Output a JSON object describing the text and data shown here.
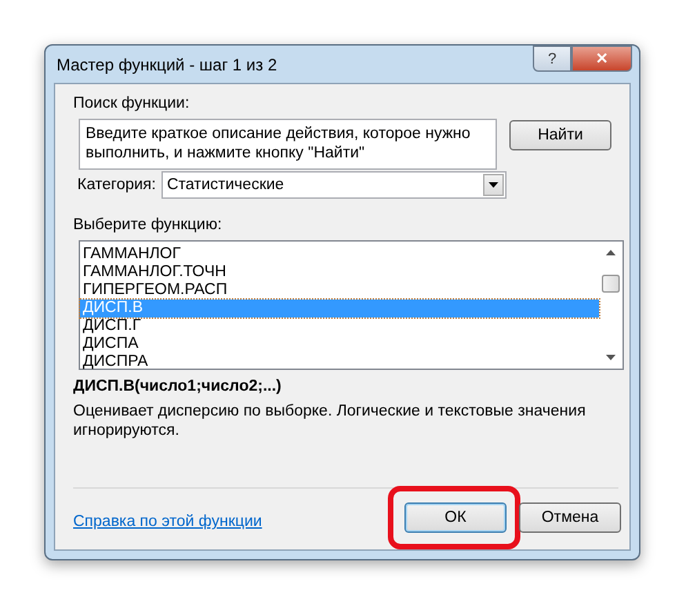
{
  "window": {
    "title": "Мастер функций - шаг 1 из 2",
    "controls": [
      "?",
      "✕"
    ]
  },
  "search": {
    "label": "Поиск функции:",
    "value": "Введите краткое описание действия, которое нужно выполнить, и нажмите кнопку \"Найти\"",
    "button": "Найти"
  },
  "category": {
    "label": "Категория:",
    "value": "Статистические"
  },
  "function_list": {
    "label": "Выберите функцию:",
    "items": [
      {
        "name": "ГАММАНЛОГ",
        "selected": false
      },
      {
        "name": "ГАММАНЛОГ.ТОЧН",
        "selected": false
      },
      {
        "name": "ГИПЕРГЕОМ.РАСП",
        "selected": false
      },
      {
        "name": "ДИСП.В",
        "selected": true
      },
      {
        "name": "ДИСП.Г",
        "selected": false
      },
      {
        "name": "ДИСПА",
        "selected": false
      },
      {
        "name": "ДИСПРА",
        "selected": false
      }
    ]
  },
  "signature": "ДИСП.В(число1;число2;...)",
  "description": "Оценивает дисперсию по выборке. Логические и текстовые значения игнорируются.",
  "help_link": "Справка по этой функции",
  "buttons": [
    {
      "label": "ОК",
      "highlighted": true
    },
    {
      "label": "Отмена",
      "highlighted": false
    }
  ]
}
